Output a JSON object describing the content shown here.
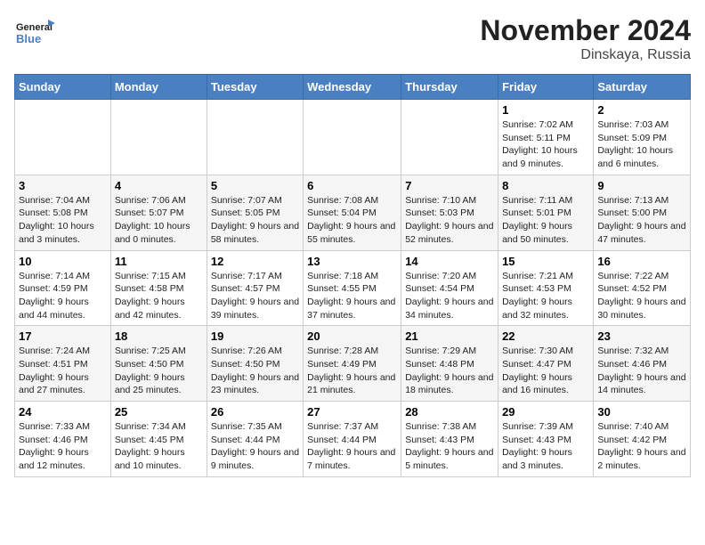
{
  "logo": {
    "line1": "General",
    "line2": "Blue"
  },
  "title": "November 2024",
  "location": "Dinskaya, Russia",
  "days_header": [
    "Sunday",
    "Monday",
    "Tuesday",
    "Wednesday",
    "Thursday",
    "Friday",
    "Saturday"
  ],
  "weeks": [
    [
      {
        "num": "",
        "info": ""
      },
      {
        "num": "",
        "info": ""
      },
      {
        "num": "",
        "info": ""
      },
      {
        "num": "",
        "info": ""
      },
      {
        "num": "",
        "info": ""
      },
      {
        "num": "1",
        "info": "Sunrise: 7:02 AM\nSunset: 5:11 PM\nDaylight: 10 hours and 9 minutes."
      },
      {
        "num": "2",
        "info": "Sunrise: 7:03 AM\nSunset: 5:09 PM\nDaylight: 10 hours and 6 minutes."
      }
    ],
    [
      {
        "num": "3",
        "info": "Sunrise: 7:04 AM\nSunset: 5:08 PM\nDaylight: 10 hours and 3 minutes."
      },
      {
        "num": "4",
        "info": "Sunrise: 7:06 AM\nSunset: 5:07 PM\nDaylight: 10 hours and 0 minutes."
      },
      {
        "num": "5",
        "info": "Sunrise: 7:07 AM\nSunset: 5:05 PM\nDaylight: 9 hours and 58 minutes."
      },
      {
        "num": "6",
        "info": "Sunrise: 7:08 AM\nSunset: 5:04 PM\nDaylight: 9 hours and 55 minutes."
      },
      {
        "num": "7",
        "info": "Sunrise: 7:10 AM\nSunset: 5:03 PM\nDaylight: 9 hours and 52 minutes."
      },
      {
        "num": "8",
        "info": "Sunrise: 7:11 AM\nSunset: 5:01 PM\nDaylight: 9 hours and 50 minutes."
      },
      {
        "num": "9",
        "info": "Sunrise: 7:13 AM\nSunset: 5:00 PM\nDaylight: 9 hours and 47 minutes."
      }
    ],
    [
      {
        "num": "10",
        "info": "Sunrise: 7:14 AM\nSunset: 4:59 PM\nDaylight: 9 hours and 44 minutes."
      },
      {
        "num": "11",
        "info": "Sunrise: 7:15 AM\nSunset: 4:58 PM\nDaylight: 9 hours and 42 minutes."
      },
      {
        "num": "12",
        "info": "Sunrise: 7:17 AM\nSunset: 4:57 PM\nDaylight: 9 hours and 39 minutes."
      },
      {
        "num": "13",
        "info": "Sunrise: 7:18 AM\nSunset: 4:55 PM\nDaylight: 9 hours and 37 minutes."
      },
      {
        "num": "14",
        "info": "Sunrise: 7:20 AM\nSunset: 4:54 PM\nDaylight: 9 hours and 34 minutes."
      },
      {
        "num": "15",
        "info": "Sunrise: 7:21 AM\nSunset: 4:53 PM\nDaylight: 9 hours and 32 minutes."
      },
      {
        "num": "16",
        "info": "Sunrise: 7:22 AM\nSunset: 4:52 PM\nDaylight: 9 hours and 30 minutes."
      }
    ],
    [
      {
        "num": "17",
        "info": "Sunrise: 7:24 AM\nSunset: 4:51 PM\nDaylight: 9 hours and 27 minutes."
      },
      {
        "num": "18",
        "info": "Sunrise: 7:25 AM\nSunset: 4:50 PM\nDaylight: 9 hours and 25 minutes."
      },
      {
        "num": "19",
        "info": "Sunrise: 7:26 AM\nSunset: 4:50 PM\nDaylight: 9 hours and 23 minutes."
      },
      {
        "num": "20",
        "info": "Sunrise: 7:28 AM\nSunset: 4:49 PM\nDaylight: 9 hours and 21 minutes."
      },
      {
        "num": "21",
        "info": "Sunrise: 7:29 AM\nSunset: 4:48 PM\nDaylight: 9 hours and 18 minutes."
      },
      {
        "num": "22",
        "info": "Sunrise: 7:30 AM\nSunset: 4:47 PM\nDaylight: 9 hours and 16 minutes."
      },
      {
        "num": "23",
        "info": "Sunrise: 7:32 AM\nSunset: 4:46 PM\nDaylight: 9 hours and 14 minutes."
      }
    ],
    [
      {
        "num": "24",
        "info": "Sunrise: 7:33 AM\nSunset: 4:46 PM\nDaylight: 9 hours and 12 minutes."
      },
      {
        "num": "25",
        "info": "Sunrise: 7:34 AM\nSunset: 4:45 PM\nDaylight: 9 hours and 10 minutes."
      },
      {
        "num": "26",
        "info": "Sunrise: 7:35 AM\nSunset: 4:44 PM\nDaylight: 9 hours and 9 minutes."
      },
      {
        "num": "27",
        "info": "Sunrise: 7:37 AM\nSunset: 4:44 PM\nDaylight: 9 hours and 7 minutes."
      },
      {
        "num": "28",
        "info": "Sunrise: 7:38 AM\nSunset: 4:43 PM\nDaylight: 9 hours and 5 minutes."
      },
      {
        "num": "29",
        "info": "Sunrise: 7:39 AM\nSunset: 4:43 PM\nDaylight: 9 hours and 3 minutes."
      },
      {
        "num": "30",
        "info": "Sunrise: 7:40 AM\nSunset: 4:42 PM\nDaylight: 9 hours and 2 minutes."
      }
    ]
  ]
}
